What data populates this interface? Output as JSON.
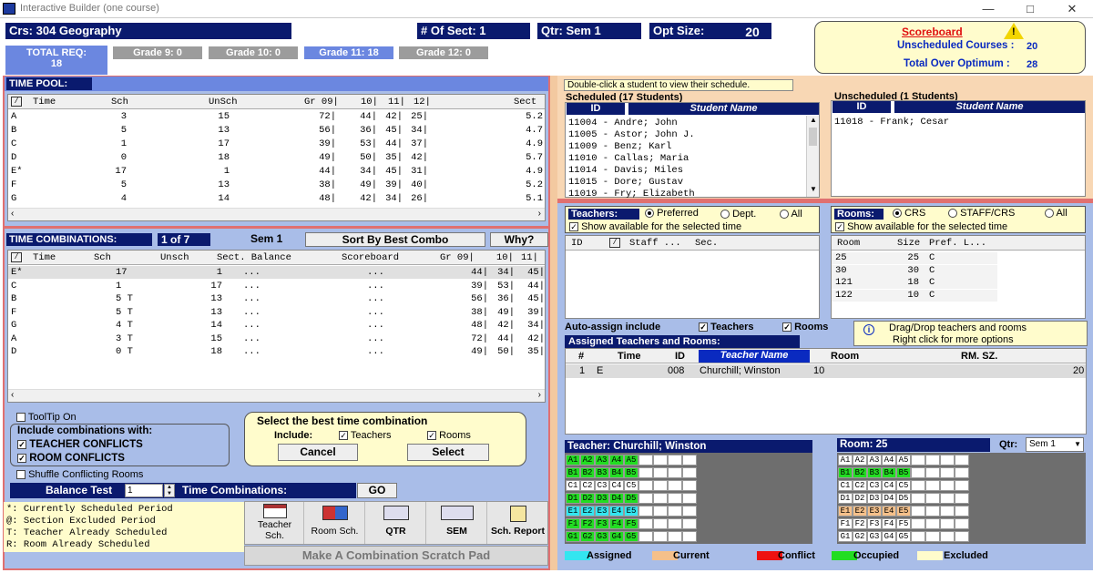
{
  "window": {
    "title": "Interactive Builder (one course)"
  },
  "header": {
    "course": "Crs: 304  Geography",
    "sections": "# Of Sect: 1",
    "qtr": "Qtr: Sem 1",
    "opt_label": "Opt Size:",
    "opt_value": "20",
    "total_req_label": "TOTAL REQ:",
    "total_req_value": "18",
    "grades": [
      "Grade 9: 0",
      "Grade 10: 0",
      "Grade 11: 18",
      "Grade 12: 0"
    ]
  },
  "scoreboard": {
    "title": "Scoreboard",
    "unsched_label": "Unscheduled Courses :",
    "unsched_value": "20",
    "over_label": "Total Over Optimum  :",
    "over_value": "28"
  },
  "time_pool": {
    "title": "TIME POOL:",
    "columns": [
      "Time",
      "Sch",
      "UnSch",
      "Gr  09|",
      "10|",
      "11|",
      "12|",
      "Sect"
    ],
    "rows": [
      [
        "A",
        "3",
        "15",
        "72|",
        "44|",
        "42|",
        "25|",
        "5.2"
      ],
      [
        "B",
        "5",
        "13",
        "56|",
        "36|",
        "45|",
        "34|",
        "4.7"
      ],
      [
        "C",
        "1",
        "17",
        "39|",
        "53|",
        "44|",
        "37|",
        "4.9"
      ],
      [
        "D",
        "0",
        "18",
        "49|",
        "50|",
        "35|",
        "42|",
        "5.7"
      ],
      [
        "E*",
        "17",
        "1",
        "44|",
        "34|",
        "45|",
        "31|",
        "4.9"
      ],
      [
        "F",
        "5",
        "13",
        "38|",
        "49|",
        "39|",
        "40|",
        "5.2"
      ],
      [
        "G",
        "4",
        "14",
        "48|",
        "42|",
        "34|",
        "26|",
        "5.1"
      ]
    ]
  },
  "time_combos": {
    "title": "TIME COMBINATIONS:",
    "page": "1  of  7",
    "sem": "Sem 1",
    "sort_btn": "Sort By Best Combo",
    "why_btn": "Why?",
    "columns": [
      "Time",
      "Sch",
      "Unsch",
      "Sect. Balance",
      "Scoreboard",
      "Gr  09|",
      "10|",
      "11|"
    ],
    "rows": [
      [
        "E*",
        "17",
        "1",
        "...",
        "...",
        "44|",
        "34|",
        "45|"
      ],
      [
        "C",
        "1",
        "17",
        "...",
        "...",
        "39|",
        "53|",
        "44|"
      ],
      [
        "B",
        "5 T",
        "13",
        "...",
        "...",
        "56|",
        "36|",
        "45|"
      ],
      [
        "F",
        "5 T",
        "13",
        "...",
        "...",
        "38|",
        "49|",
        "39|"
      ],
      [
        "G",
        "4 T",
        "14",
        "...",
        "...",
        "48|",
        "42|",
        "34|"
      ],
      [
        "A",
        "3 T",
        "15",
        "...",
        "...",
        "72|",
        "44|",
        "42|"
      ],
      [
        "D",
        "0 T",
        "18",
        "...",
        "...",
        "49|",
        "50|",
        "35|"
      ]
    ]
  },
  "options": {
    "tooltip": "ToolTip On",
    "include_label": "Include combinations with:",
    "teacher_conf": "TEACHER CONFLICTS",
    "room_conf": "ROOM CONFLICTS",
    "shuffle": "Shuffle Conflicting Rooms",
    "balance_label": "Balance Test",
    "balance_value": "1",
    "time_combos_label": "Time Combinations:",
    "go": "GO"
  },
  "select_box": {
    "title": "Select the best time combination",
    "include": "Include:",
    "teachers": "Teachers",
    "rooms": "Rooms",
    "cancel": "Cancel",
    "select": "Select"
  },
  "legend_notes": [
    "*: Currently Scheduled Period",
    "@: Section Excluded Period",
    "T: Teacher Already Scheduled",
    "R: Room Already Scheduled"
  ],
  "toolbar": {
    "buttons": [
      "Teacher Sch.",
      "Room Sch.",
      "QTR",
      "SEM",
      "Sch. Report"
    ],
    "scratch": "Make A Combination Scratch Pad"
  },
  "students": {
    "hint": "Double-click a student to view their schedule.",
    "sched_title": "Scheduled (17 Students)",
    "unsched_title": "Unscheduled (1 Students)",
    "id_col": "ID",
    "name_col": "Student Name",
    "scheduled": [
      "11004 - Andre; John",
      "11005 - Astor; John J.",
      "11009 - Benz; Karl",
      "11010 - Callas; Maria",
      "11014 - Davis; Miles",
      "11015 - Dore; Gustav",
      "11019 - Fry; Elizabeth"
    ],
    "unscheduled": [
      "11018 - Frank; Cesar"
    ]
  },
  "teachers": {
    "label": "Teachers:",
    "opt1": "Preferred",
    "opt2": "Dept.",
    "opt3": "All",
    "show": "Show available for the selected time",
    "cols": [
      "ID",
      "Staff ...",
      "Sec."
    ]
  },
  "rooms": {
    "label": "Rooms:",
    "opt1": "CRS",
    "opt2": "STAFF/CRS",
    "opt3": "All",
    "show": "Show available for the selected time",
    "cols": [
      "Room",
      "Size",
      "Pref. L..."
    ],
    "rows": [
      [
        "25",
        "25",
        "C"
      ],
      [
        "30",
        "30",
        "C"
      ],
      [
        "121",
        "18",
        "C"
      ],
      [
        "122",
        "10",
        "C"
      ]
    ]
  },
  "auto_assign": {
    "label": "Auto-assign include",
    "teachers": "Teachers",
    "rooms": "Rooms",
    "hint1": "Drag/Drop teachers and rooms",
    "hint2": "Right click for more options"
  },
  "assigned": {
    "title": "Assigned Teachers and Rooms:",
    "cols": [
      "#",
      "Time",
      "ID",
      "Teacher Name",
      "Room",
      "RM. SZ."
    ],
    "rows": [
      [
        "1",
        "E",
        "008",
        "Churchill; Winston",
        "10",
        "20"
      ]
    ]
  },
  "teacher_grid": {
    "title": "Teacher: Churchill; Winston"
  },
  "room_grid": {
    "title": "Room: 25",
    "qtr_label": "Qtr:",
    "qtr_value": "Sem 1"
  },
  "grid_rows": [
    [
      "A1",
      "A2",
      "A3",
      "A4",
      "A5"
    ],
    [
      "B1",
      "B2",
      "B3",
      "B4",
      "B5"
    ],
    [
      "C1",
      "C2",
      "C3",
      "C4",
      "C5"
    ],
    [
      "D1",
      "D2",
      "D3",
      "D4",
      "D5"
    ],
    [
      "E1",
      "E2",
      "E3",
      "E4",
      "E5"
    ],
    [
      "F1",
      "F2",
      "F3",
      "F4",
      "F5"
    ],
    [
      "G1",
      "G2",
      "G3",
      "G4",
      "G5"
    ]
  ],
  "colors": {
    "assigned": "#33e6f0",
    "current": "#f5c08a",
    "conflict": "#ee1111",
    "occupied": "#22dd22",
    "excluded": "#fffccc"
  },
  "legend": {
    "assigned": "Assigned",
    "current": "Current",
    "conflict": "Conflict",
    "occupied": "Occupied",
    "excluded": "Excluded"
  }
}
